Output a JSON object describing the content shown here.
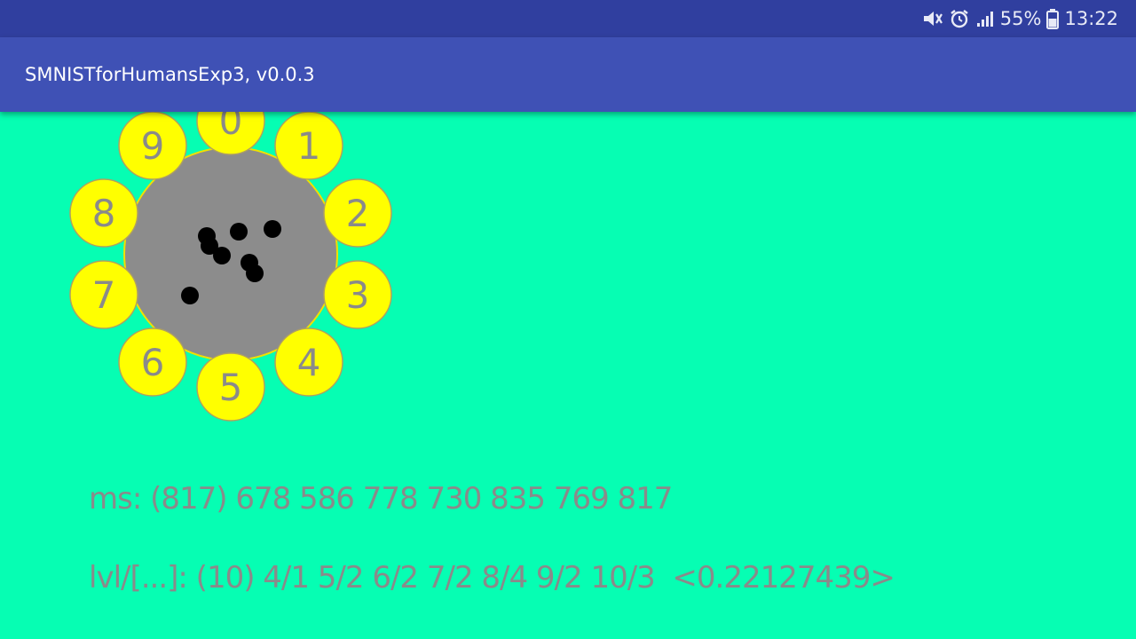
{
  "status_bar": {
    "icons": [
      "mute-icon",
      "alarm-icon",
      "signal-icon",
      "battery-icon"
    ],
    "battery": "55%",
    "time": "13:22"
  },
  "app_bar": {
    "title": "SMNISTforHumansExp3, v0.0.3"
  },
  "dial": {
    "digits": [
      "0",
      "1",
      "2",
      "3",
      "4",
      "5",
      "6",
      "7",
      "8",
      "9"
    ]
  },
  "info": {
    "ms_line": "ms: (817) 678 586 778 730 835 769 817",
    "lvl_line": "lvl/[...]: (10) 4/1 5/2 6/2 7/2 8/4 9/2 10/3  <0.22127439>"
  },
  "colors": {
    "background": "#06feb3",
    "status_bar": "#303f9f",
    "app_bar": "#3f51b5",
    "dial_center": "#8c8c8c",
    "digit_circle": "#ffff00",
    "digit_text": "#8a8a8a",
    "dot": "#000000"
  }
}
